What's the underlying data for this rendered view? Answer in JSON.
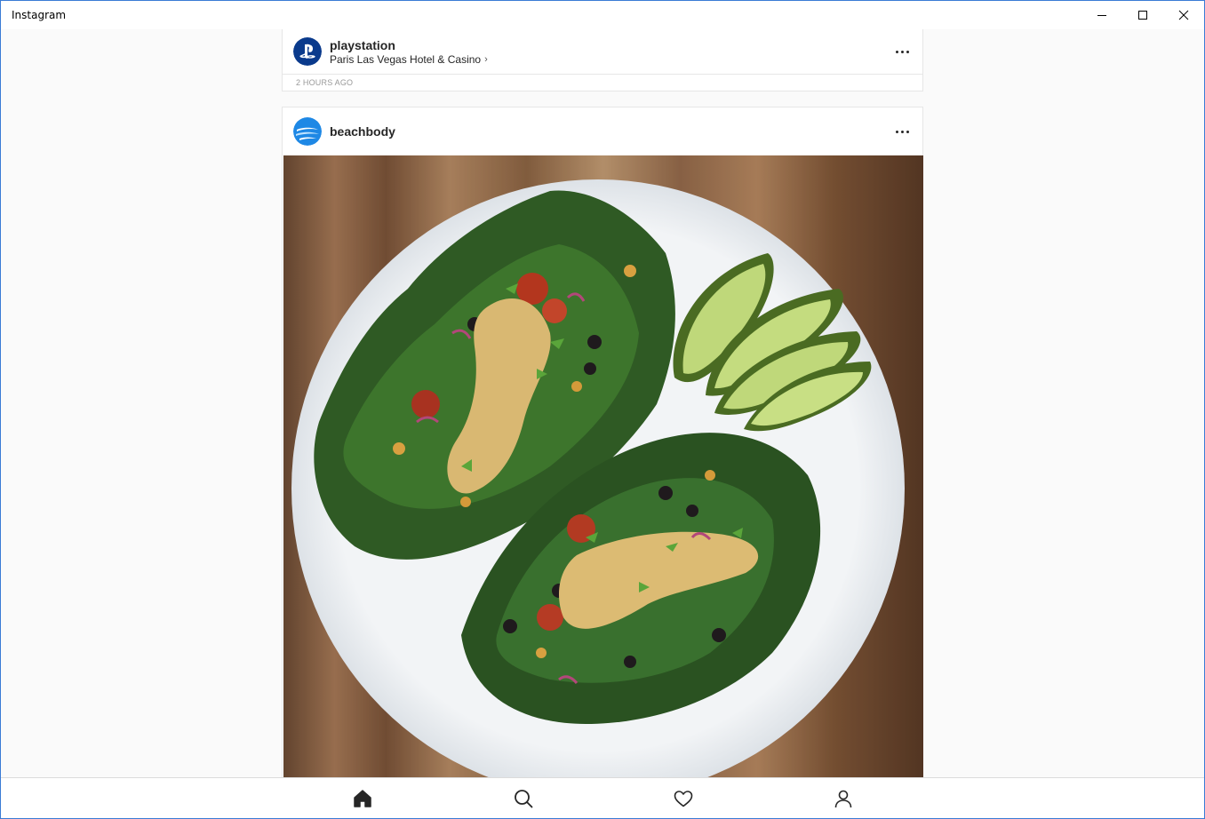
{
  "window": {
    "title": "Instagram",
    "controls": [
      "minimize-icon",
      "maximize-icon",
      "close-icon"
    ]
  },
  "feed": {
    "posts": [
      {
        "username": "playstation",
        "location": "Paris Las Vegas Hotel & Casino",
        "timestamp": "2 HOURS AGO",
        "avatar_icon": "playstation-logo-icon",
        "avatar_color": "#0a3a8c"
      },
      {
        "username": "beachbody",
        "avatar_icon": "beachbody-logo-icon",
        "avatar_color": "#1e88e5",
        "image_icon": "food-plate-photo"
      }
    ]
  },
  "bottom_nav": {
    "items": [
      "home-icon",
      "search-icon",
      "heart-icon",
      "profile-icon"
    ],
    "active": "home-icon"
  }
}
